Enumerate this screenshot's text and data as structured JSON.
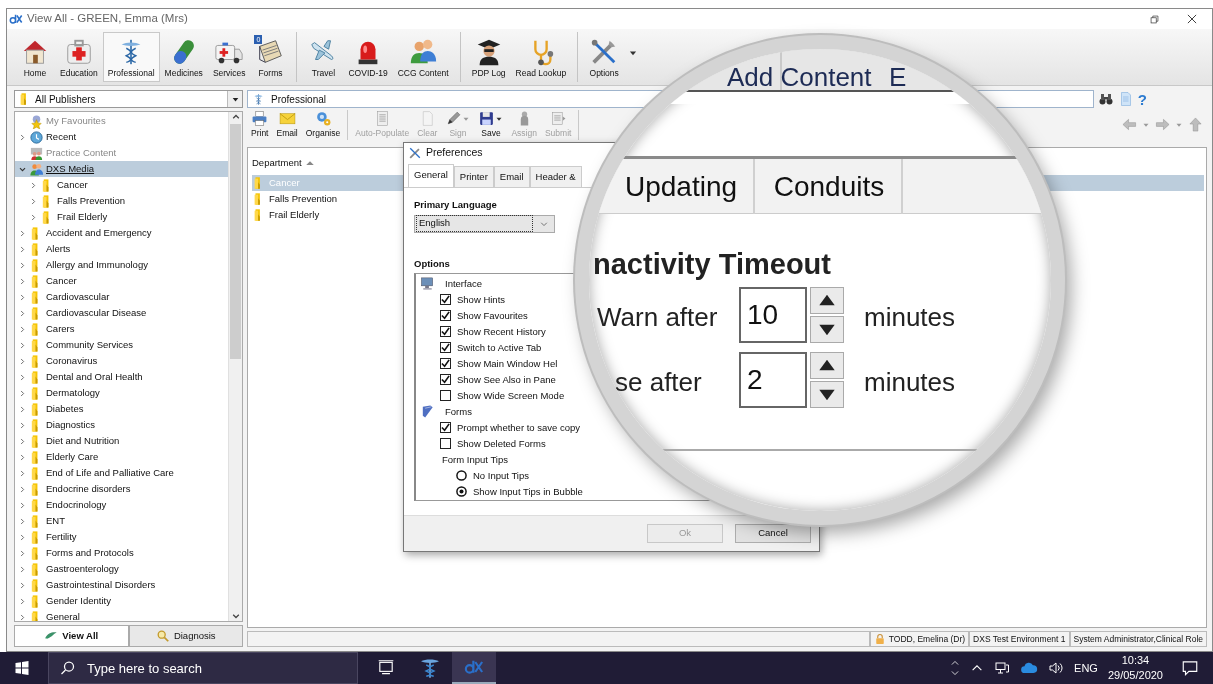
{
  "window": {
    "title": "View All  -  GREEN, Emma (Mrs)"
  },
  "ribbon_groups": [
    [
      {
        "label": "Home",
        "kind": "house",
        "selected": false
      },
      {
        "label": "Education",
        "kind": "kit",
        "selected": false
      },
      {
        "label": "Professional",
        "kind": "caduceus",
        "selected": true
      },
      {
        "label": "Medicines",
        "kind": "pill",
        "selected": false
      },
      {
        "label": "Services",
        "kind": "ambulance",
        "selected": false
      },
      {
        "label": "Forms",
        "kind": "clipboard",
        "selected": false,
        "badge": "0"
      }
    ],
    [
      {
        "label": "Travel",
        "kind": "plane",
        "selected": false
      },
      {
        "label": "COVID-19",
        "kind": "siren",
        "selected": false
      },
      {
        "label": "CCG Content",
        "kind": "people",
        "selected": false
      }
    ],
    [
      {
        "label": "PDP Log",
        "kind": "graduate",
        "selected": false
      },
      {
        "label": "Read Lookup",
        "kind": "stethoscope",
        "selected": false
      }
    ],
    [
      {
        "label": "Options",
        "kind": "tools",
        "selected": false,
        "dropdown": true
      }
    ]
  ],
  "publisher_select": {
    "value": "All Publishers"
  },
  "address_bar": {
    "value": "Professional",
    "help": "?"
  },
  "tree": [
    {
      "label": "My Favourites",
      "kind": "favourites",
      "dimmed": true,
      "selected": false
    },
    {
      "label": "Recent",
      "kind": "recent",
      "dimmed": false,
      "selected": false,
      "expanded": false
    },
    {
      "label": "Practice Content",
      "kind": "practice",
      "dimmed": true,
      "selected": false
    },
    {
      "label": "DXS Media",
      "kind": "publisher",
      "dimmed": false,
      "selected": true,
      "expanded": true,
      "children": [
        {
          "label": "Cancer",
          "kind": "folder",
          "dimmed": false,
          "selected": false,
          "expanded": false
        },
        {
          "label": "Falls Prevention",
          "kind": "folder",
          "dimmed": false,
          "selected": false,
          "expanded": false
        },
        {
          "label": "Frail Elderly",
          "kind": "folder",
          "dimmed": false,
          "selected": false,
          "expanded": false
        }
      ]
    },
    {
      "label": "Accident and Emergency",
      "kind": "folder",
      "dimmed": false,
      "selected": false,
      "expanded": false
    },
    {
      "label": "Alerts",
      "kind": "folder",
      "dimmed": false,
      "selected": false,
      "expanded": false
    },
    {
      "label": "Allergy and Immunology",
      "kind": "folder",
      "dimmed": false,
      "selected": false,
      "expanded": false
    },
    {
      "label": "Cancer",
      "kind": "folder",
      "dimmed": false,
      "selected": false,
      "expanded": false
    },
    {
      "label": "Cardiovascular",
      "kind": "folder",
      "dimmed": false,
      "selected": false,
      "expanded": false
    },
    {
      "label": "Cardiovascular Disease",
      "kind": "folder",
      "dimmed": false,
      "selected": false,
      "expanded": false
    },
    {
      "label": "Carers",
      "kind": "folder",
      "dimmed": false,
      "selected": false,
      "expanded": false
    },
    {
      "label": "Community Services",
      "kind": "folder",
      "dimmed": false,
      "selected": false,
      "expanded": false
    },
    {
      "label": "Coronavirus",
      "kind": "folder",
      "dimmed": false,
      "selected": false,
      "expanded": false
    },
    {
      "label": "Dental and Oral Health",
      "kind": "folder",
      "dimmed": false,
      "selected": false,
      "expanded": false
    },
    {
      "label": "Dermatology",
      "kind": "folder",
      "dimmed": false,
      "selected": false,
      "expanded": false
    },
    {
      "label": "Diabetes",
      "kind": "folder",
      "dimmed": false,
      "selected": false,
      "expanded": false
    },
    {
      "label": "Diagnostics",
      "kind": "folder",
      "dimmed": false,
      "selected": false,
      "expanded": false
    },
    {
      "label": "Diet and Nutrition",
      "kind": "folder",
      "dimmed": false,
      "selected": false,
      "expanded": false
    },
    {
      "label": "Elderly Care",
      "kind": "folder",
      "dimmed": false,
      "selected": false,
      "expanded": false
    },
    {
      "label": "End of Life and Palliative Care",
      "kind": "folder",
      "dimmed": false,
      "selected": false,
      "expanded": false
    },
    {
      "label": "Endocrine disorders",
      "kind": "folder",
      "dimmed": false,
      "selected": false,
      "expanded": false
    },
    {
      "label": "Endocrinology",
      "kind": "folder",
      "dimmed": false,
      "selected": false,
      "expanded": false
    },
    {
      "label": "ENT",
      "kind": "folder",
      "dimmed": false,
      "selected": false,
      "expanded": false
    },
    {
      "label": "Fertility",
      "kind": "folder",
      "dimmed": false,
      "selected": false,
      "expanded": false
    },
    {
      "label": "Forms and Protocols",
      "kind": "folder",
      "dimmed": false,
      "selected": false,
      "expanded": false
    },
    {
      "label": "Gastroenterology",
      "kind": "folder",
      "dimmed": false,
      "selected": false,
      "expanded": false
    },
    {
      "label": "Gastrointestinal Disorders",
      "kind": "folder",
      "dimmed": false,
      "selected": false,
      "expanded": false
    },
    {
      "label": "Gender Identity",
      "kind": "folder",
      "dimmed": false,
      "selected": false,
      "expanded": false
    },
    {
      "label": "General",
      "kind": "folder",
      "dimmed": false,
      "selected": false,
      "expanded": false
    }
  ],
  "left_tabs": [
    {
      "label": "View All",
      "kind": "leaf",
      "selected": true
    },
    {
      "label": "Diagnosis",
      "kind": "search",
      "selected": false
    }
  ],
  "doc_toolbar": [
    [
      {
        "label": "Print",
        "kind": "printer",
        "disabled": false
      },
      {
        "label": "Email",
        "kind": "envelope",
        "disabled": false
      },
      {
        "label": "Organise",
        "kind": "gears",
        "disabled": false
      }
    ],
    [
      {
        "label": "Auto-Populate",
        "kind": "document",
        "disabled": true
      },
      {
        "label": "Clear",
        "kind": "page",
        "disabled": true
      },
      {
        "label": "Sign",
        "kind": "pencil",
        "disabled": true,
        "dropdown": true
      },
      {
        "label": "Save",
        "kind": "floppy",
        "disabled": false,
        "dropdown": true
      },
      {
        "label": "Assign",
        "kind": "person",
        "disabled": true
      },
      {
        "label": "Submit",
        "kind": "submit",
        "disabled": true
      }
    ]
  ],
  "list": {
    "column": "Department",
    "sorted_ascending": true,
    "rows": [
      {
        "label": "Cancer",
        "selected": true
      },
      {
        "label": "Falls Prevention",
        "selected": false
      },
      {
        "label": "Frail Elderly",
        "selected": false
      }
    ]
  },
  "status_bar": [
    {
      "text": "TODD, Emelina (Dr)",
      "kind": "user"
    },
    {
      "text": "DXS Test Environment 1",
      "kind": "plain"
    },
    {
      "text": "System Administrator,Clinical Role",
      "kind": "plain"
    }
  ],
  "dialog": {
    "title": "Preferences",
    "tabs": [
      {
        "label": "General",
        "selected": true
      },
      {
        "label": "Printer",
        "selected": false
      },
      {
        "label": "Email",
        "selected": false
      },
      {
        "label": "Header &",
        "selected": false
      }
    ],
    "language_label": "Primary Language",
    "language": "English",
    "options_label": "Options",
    "options": [
      {
        "kind": "group",
        "label": "Interface"
      },
      {
        "kind": "check",
        "label": "Show Hints",
        "checked": true
      },
      {
        "kind": "check",
        "label": "Show Favourites",
        "checked": true
      },
      {
        "kind": "check",
        "label": "Show Recent History",
        "checked": true
      },
      {
        "kind": "check",
        "label": "Switch to Active Tab",
        "checked": true
      },
      {
        "kind": "check",
        "label": "Show Main Window Hel",
        "checked": true
      },
      {
        "kind": "check",
        "label": "Show See Also in Pane",
        "checked": true
      },
      {
        "kind": "check",
        "label": "Show Wide Screen Mode",
        "checked": false
      },
      {
        "kind": "group",
        "label": "Forms"
      },
      {
        "kind": "check",
        "label": "Prompt whether to save copy",
        "checked": true
      },
      {
        "kind": "check",
        "label": "Show Deleted Forms",
        "checked": false
      },
      {
        "kind": "label",
        "label": "Form Input Tips"
      },
      {
        "kind": "radio",
        "label": "No Input Tips",
        "selected": false
      },
      {
        "kind": "radio",
        "label": "Show Input Tips in Bubble",
        "selected": true
      }
    ],
    "buttons": [
      {
        "label": "Ok",
        "disabled": true
      },
      {
        "label": "Cancel",
        "disabled": false
      }
    ]
  },
  "magnifier": {
    "toolbar_texts": [
      "Add Content",
      "E"
    ],
    "tabs": [
      "Updating",
      "Conduits"
    ],
    "heading": "nactivity Timeout",
    "rows": [
      {
        "label": "Warn after",
        "value": "10",
        "unit": "minutes"
      },
      {
        "label": "se after",
        "value": "2",
        "unit": "minutes"
      }
    ]
  },
  "taskbar": {
    "search_placeholder": "Type here to search",
    "language": "ENG",
    "time": "10:34",
    "date": "29/05/2020"
  }
}
